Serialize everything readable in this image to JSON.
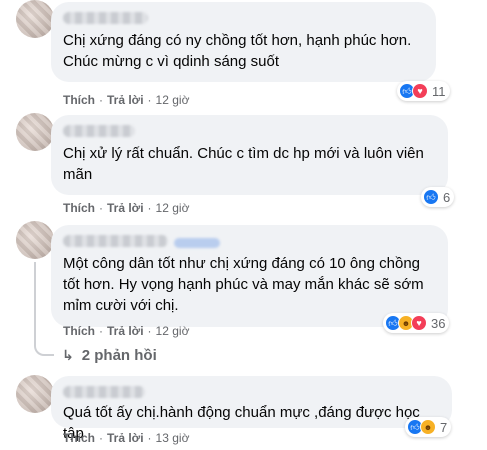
{
  "comments": [
    {
      "text": "Chị xứng đáng có ny chồng tốt hơn, hạnh phúc hơn.\nChúc mừng c vì qdinh sáng suốt",
      "actions": {
        "like": "Thích",
        "reply": "Trả lời",
        "time": "12 giờ"
      },
      "reactions": {
        "icons": [
          "like",
          "love"
        ],
        "count": "11"
      }
    },
    {
      "text": "Chị xử lý rất chuẩn. Chúc c tìm dc hp mới và luôn viên\nmãn",
      "actions": {
        "like": "Thích",
        "reply": "Trả lời",
        "time": "12 giờ"
      },
      "reactions": {
        "icons": [
          "like"
        ],
        "count": "6"
      }
    },
    {
      "text": "Một công dân tốt như chị xứng đáng có 10 ông chồng\ntốt hơn. Hy vọng hạnh phúc và may mắn khác sẽ sớm\nmỉm cười với chị.",
      "actions": {
        "like": "Thích",
        "reply": "Trả lời",
        "time": "12 giờ"
      },
      "reactions": {
        "icons": [
          "like",
          "haha",
          "love"
        ],
        "count": "36"
      },
      "replies_label": "2 phản hồi"
    },
    {
      "text": "Quá tốt ấy chị.hành động chuẩn mực ,đáng được học tập",
      "actions": {
        "like": "Thích",
        "reply": "Trả lời",
        "time": "13 giờ"
      },
      "reactions": {
        "icons": [
          "like",
          "haha"
        ],
        "count": "7"
      }
    }
  ],
  "colors": {
    "bubble": "#f0f2f5",
    "like": "#1877f2",
    "love": "#f33e58",
    "haha": "#f7b125",
    "muted": "#65676b"
  },
  "icons": {
    "like": "thumbs-up-icon",
    "love": "heart-icon",
    "haha": "laughing-face-icon",
    "reply_arrow": "reply-arrow-icon"
  }
}
